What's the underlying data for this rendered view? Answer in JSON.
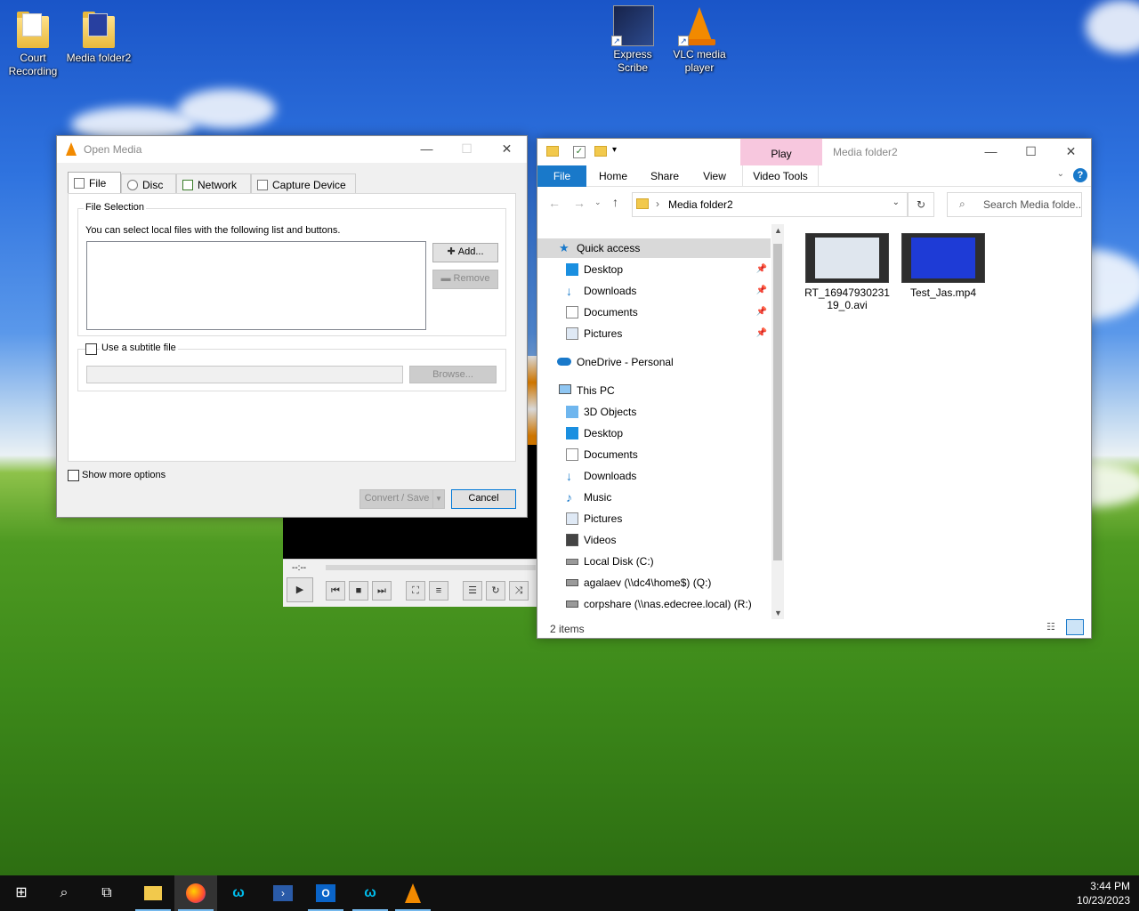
{
  "desktop": {
    "icons": [
      {
        "label": "Court Recording"
      },
      {
        "label": "Media folder2"
      },
      {
        "label": "Express Scribe"
      },
      {
        "label": "VLC media player"
      }
    ]
  },
  "open_media": {
    "title": "Open Media",
    "tabs": [
      {
        "label": "File"
      },
      {
        "label": "Disc"
      },
      {
        "label": "Network"
      },
      {
        "label": "Capture Device"
      }
    ],
    "file_selection_label": "File Selection",
    "file_selection_hint": "You can select local files with the following list and buttons.",
    "add_label": "Add...",
    "remove_label": "Remove",
    "subtitle_label": "Use a subtitle file",
    "browse_label": "Browse...",
    "show_more_label": "Show more options",
    "convert_label": "Convert / Save",
    "cancel_label": "Cancel",
    "window_controls": {
      "minimize": "—",
      "maximize": "☐",
      "close": "✕"
    }
  },
  "vlc_player": {
    "time_label": "--:--"
  },
  "explorer": {
    "title": "Media folder2",
    "context_tab": "Play",
    "ribbon_tabs": [
      {
        "label": "File"
      },
      {
        "label": "Home"
      },
      {
        "label": "Share"
      },
      {
        "label": "View"
      },
      {
        "label": "Video Tools"
      }
    ],
    "address": "Media folder2",
    "search_placeholder": "Search Media folde...",
    "nav": {
      "quick_access": "Quick access",
      "quick_items": [
        {
          "label": "Desktop"
        },
        {
          "label": "Downloads"
        },
        {
          "label": "Documents"
        },
        {
          "label": "Pictures"
        }
      ],
      "onedrive": "OneDrive - Personal",
      "this_pc": "This PC",
      "pc_items": [
        {
          "label": "3D Objects"
        },
        {
          "label": "Desktop"
        },
        {
          "label": "Documents"
        },
        {
          "label": "Downloads"
        },
        {
          "label": "Music"
        },
        {
          "label": "Pictures"
        },
        {
          "label": "Videos"
        },
        {
          "label": "Local Disk (C:)"
        },
        {
          "label": "agalaev (\\\\dc4\\home$) (Q:)"
        },
        {
          "label": "corpshare (\\\\nas.edecree.local) (R:)"
        }
      ]
    },
    "files": [
      {
        "name": "RT_1694793023119_0.avi"
      },
      {
        "name": "Test_Jas.mp4"
      }
    ],
    "status": "2 items",
    "window_controls": {
      "minimize": "—",
      "maximize": "☐",
      "close": "✕"
    }
  },
  "taskbar": {
    "time": "3:44 PM",
    "date": "10/23/2023"
  },
  "colors": {
    "accent_blue": "#1979ca",
    "play_tab_pink": "#f7c7de",
    "vlc_orange": "#f28a00"
  }
}
